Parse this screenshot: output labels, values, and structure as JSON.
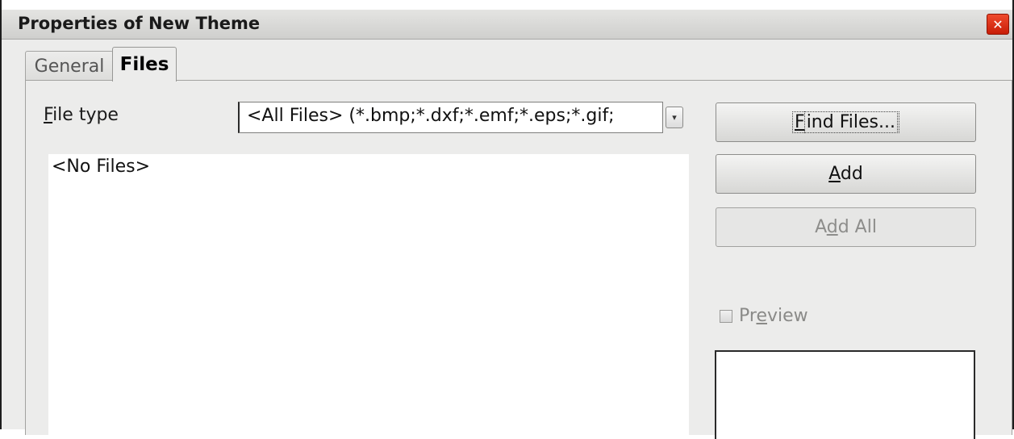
{
  "window": {
    "title": "Properties of New Theme",
    "close_glyph": "✕"
  },
  "tabs": [
    {
      "label": "General",
      "active": false
    },
    {
      "label": "Files",
      "active": true
    }
  ],
  "files_tab": {
    "file_type_label_prefix": "",
    "file_type_mnemonic": "F",
    "file_type_label_rest": "ile type",
    "file_type_value": "<All Files> (*.bmp;*.dxf;*.emf;*.eps;*.gif;",
    "dropdown_glyph": "⌄",
    "file_list_empty": "<No Files>",
    "buttons": {
      "find_files": {
        "mnemonic": "F",
        "rest": "ind Files...",
        "enabled": true
      },
      "add": {
        "mnemonic": "A",
        "rest": "dd",
        "enabled": true
      },
      "add_all": {
        "prefix": "A",
        "mnemonic": "d",
        "rest": "d All",
        "enabled": false
      }
    },
    "preview": {
      "prefix": "Pr",
      "mnemonic": "e",
      "rest": "view",
      "checked": false,
      "enabled": false
    }
  },
  "colors": {
    "close_button": "#d52b0e",
    "dialog_bg": "#ececeb"
  }
}
